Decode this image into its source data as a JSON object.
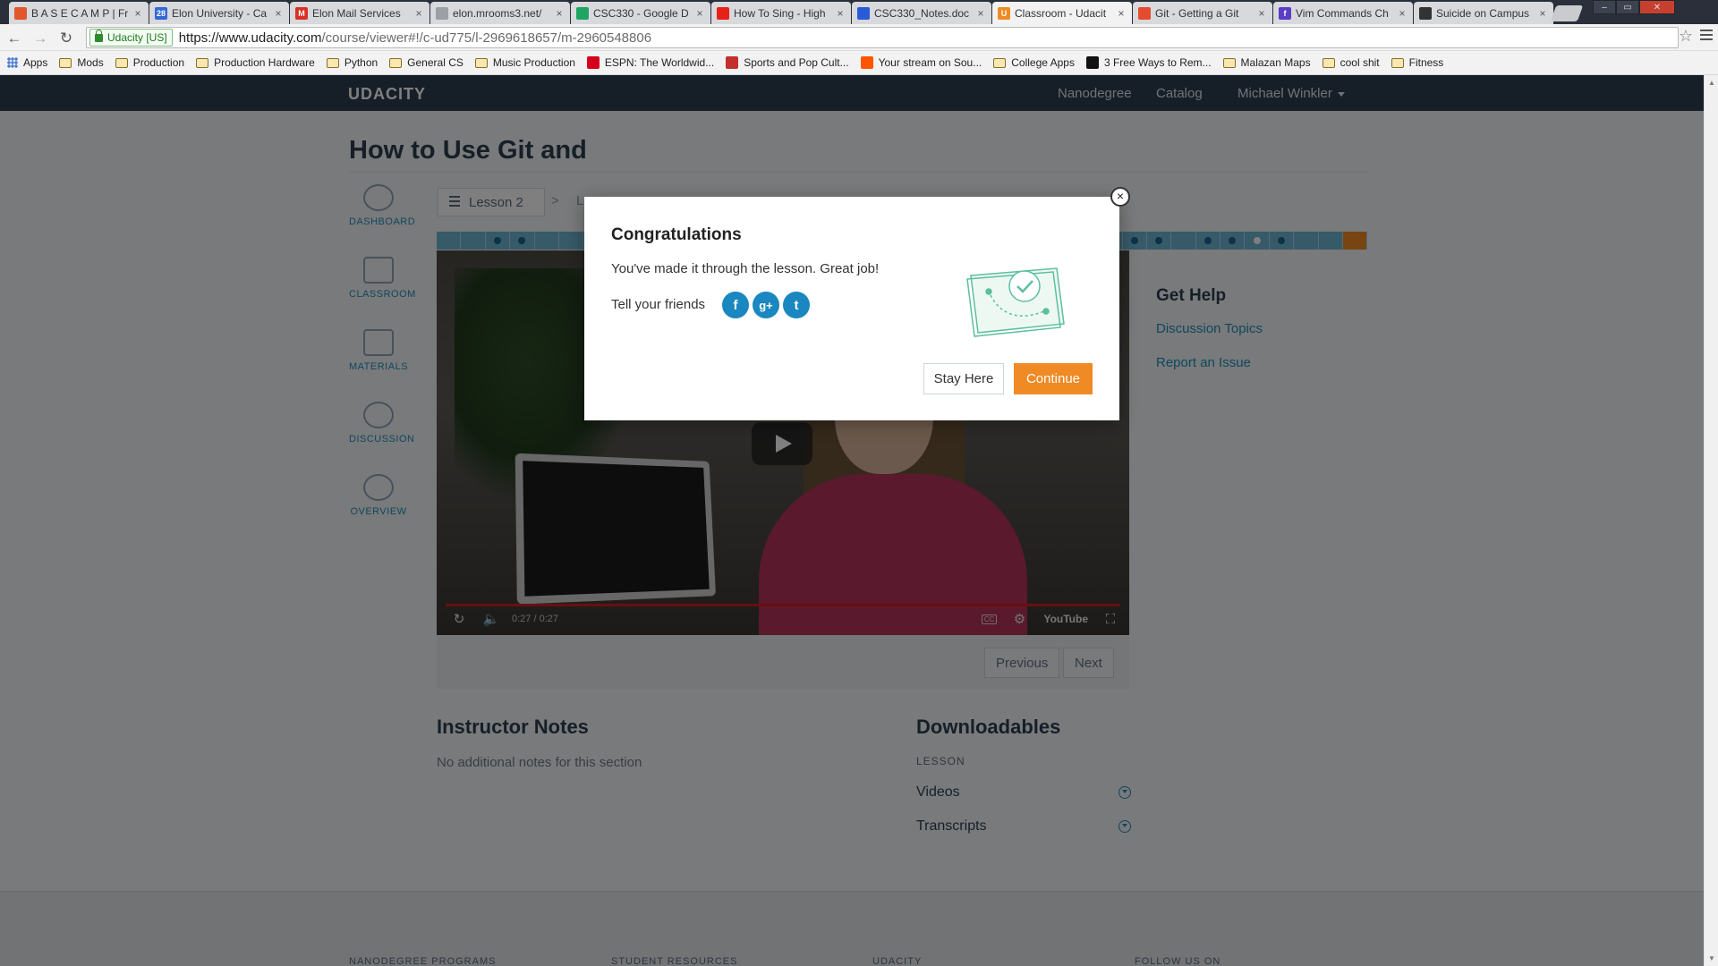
{
  "browser": {
    "tabs": [
      {
        "title": "B A S E C A M P | Fr",
        "favicon_color": "#e2562b"
      },
      {
        "title": "Elon University - Ca",
        "favicon_color": "#3367d6",
        "favicon_text": "28"
      },
      {
        "title": "Elon Mail Services",
        "favicon_color": "#d93025",
        "favicon_text": "M"
      },
      {
        "title": "elon.mrooms3.net/",
        "favicon_color": "#9aa0a6"
      },
      {
        "title": "CSC330 - Google D",
        "favicon_color": "#1fa463"
      },
      {
        "title": "How To Sing - High",
        "favicon_color": "#e62117"
      },
      {
        "title": "CSC330_Notes.doc",
        "favicon_color": "#2a5bd7"
      },
      {
        "title": "Classroom - Udacit",
        "favicon_color": "#f08a24",
        "favicon_text": "U",
        "active": true
      },
      {
        "title": "Git - Getting a Git",
        "favicon_color": "#e44c30"
      },
      {
        "title": "Vim Commands Ch",
        "favicon_color": "#5b3cc4",
        "favicon_text": "f"
      },
      {
        "title": "Suicide on Campus",
        "favicon_color": "#333333"
      }
    ],
    "address": {
      "secure_label": "Udacity [US]",
      "url_host": "https://www.udacity.com",
      "url_path": "/course/viewer#!/c-ud775/l-2969618657/m-2960548806"
    },
    "bookmarks": [
      {
        "label": "Apps",
        "kind": "apps"
      },
      {
        "label": "Mods",
        "kind": "folder"
      },
      {
        "label": "Production",
        "kind": "folder"
      },
      {
        "label": "Production Hardware",
        "kind": "folder"
      },
      {
        "label": "Python",
        "kind": "folder"
      },
      {
        "label": "General CS",
        "kind": "folder"
      },
      {
        "label": "Music Production",
        "kind": "folder"
      },
      {
        "label": "ESPN: The Worldwid...",
        "kind": "site",
        "color": "#d6001c"
      },
      {
        "label": "Sports and Pop Cult...",
        "kind": "site",
        "color": "#c4302b"
      },
      {
        "label": "Your stream on Sou...",
        "kind": "site",
        "color": "#ff5500"
      },
      {
        "label": "College Apps",
        "kind": "folder"
      },
      {
        "label": "3 Free Ways to Rem...",
        "kind": "site",
        "color": "#111111"
      },
      {
        "label": "Malazan Maps",
        "kind": "folder"
      },
      {
        "label": "cool shit",
        "kind": "folder"
      },
      {
        "label": "Fitness",
        "kind": "folder"
      }
    ]
  },
  "udacity": {
    "logo": "UDACITY",
    "nav": {
      "nanodegree": "Nanodegree",
      "catalog": "Catalog",
      "user": "Michael Winkler"
    },
    "course_title": "How to Use Git and",
    "sidenav": [
      {
        "label": "DASHBOARD",
        "icon": "dashboard-icon"
      },
      {
        "label": "CLASSROOM",
        "icon": "play-icon"
      },
      {
        "label": "MATERIALS",
        "icon": "notebook-icon"
      },
      {
        "label": "DISCUSSION",
        "icon": "chat-bubble-icon"
      },
      {
        "label": "OVERVIEW",
        "icon": "info-icon"
      }
    ],
    "breadcrumb": {
      "lesson": "Lesson 2",
      "sep": ">",
      "next": "L"
    },
    "video": {
      "time": "0:27 / 0:27",
      "youtube": "YouTube"
    },
    "pager": {
      "previous": "Previous",
      "next": "Next"
    },
    "instructor_notes": {
      "heading": "Instructor Notes",
      "text": "No additional notes for this section"
    },
    "downloadables": {
      "heading": "Downloadables",
      "section_label": "LESSON",
      "items": [
        "Videos",
        "Transcripts"
      ]
    },
    "help": {
      "heading": "Get Help",
      "links": [
        "Discussion Topics",
        "Report an Issue"
      ]
    },
    "footer": [
      "NANODEGREE PROGRAMS",
      "STUDENT RESOURCES",
      "UDACITY",
      "FOLLOW US ON"
    ]
  },
  "modal": {
    "title": "Congratulations",
    "message": "You've made it through the lesson. Great job!",
    "tell_friends": "Tell your friends",
    "share": [
      {
        "network": "facebook",
        "glyph": "f"
      },
      {
        "network": "google-plus",
        "glyph": "g+"
      },
      {
        "network": "twitter",
        "glyph": "t"
      }
    ],
    "stay_label": "Stay Here",
    "continue_label": "Continue",
    "close_glyph": "×"
  },
  "colors": {
    "accent": "#f08a24",
    "navy": "#2d3e50",
    "link": "#1e8fbc"
  }
}
